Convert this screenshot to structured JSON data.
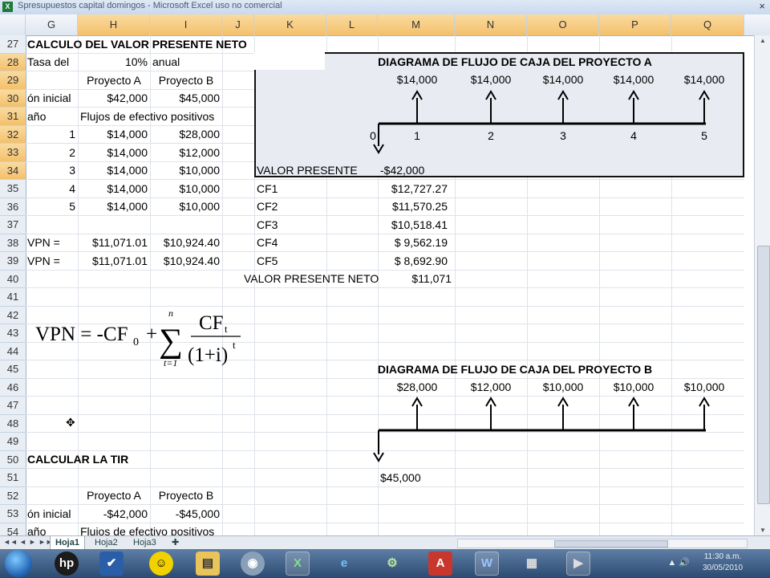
{
  "window": {
    "title": "Spresupuestos capital domingos - Microsoft Excel uso no comercial"
  },
  "columns": [
    "G",
    "H",
    "I",
    "J",
    "K",
    "L",
    "M",
    "N",
    "O",
    "P",
    "Q"
  ],
  "selected_columns": [
    "H",
    "I",
    "J",
    "K",
    "L",
    "M",
    "N",
    "O",
    "P",
    "Q"
  ],
  "rows": [
    "27",
    "28",
    "29",
    "30",
    "31",
    "32",
    "33",
    "34",
    "35",
    "36",
    "37",
    "38",
    "39",
    "40",
    "41",
    "42",
    "43",
    "44",
    "45",
    "46",
    "47",
    "48",
    "49",
    "50",
    "51",
    "52",
    "53",
    "54"
  ],
  "selected_rows": [
    "28",
    "29",
    "30",
    "31",
    "32",
    "33",
    "34"
  ],
  "cells": {
    "g27": "CALCULO DEL VALOR PRESENTE NETO",
    "g28": "Tasa del",
    "h28": "10%",
    "i28": "anual",
    "h29": "Proyecto A",
    "i29": "Proyecto B",
    "g30": "ón inicial",
    "h30": "$42,000",
    "i30": "$45,000",
    "g31": "año",
    "h31": "Flujos de efectivo positivos",
    "g32": "1",
    "h32": "$14,000",
    "i32": "$28,000",
    "g33": "2",
    "h33": "$14,000",
    "i33": "$12,000",
    "g34": "3",
    "h34": "$14,000",
    "i34": "$10,000",
    "g35": "4",
    "h35": "$14,000",
    "i35": "$10,000",
    "g36": "5",
    "h36": "$14,000",
    "i36": "$10,000",
    "g38": "VPN =",
    "h38": "$11,071.01",
    "i38": "$10,924.40",
    "g39": "VPN =",
    "h39": "$11,071.01",
    "i39": "$10,924.40",
    "k34": "VALOR PRESENTE",
    "m34": "-$42,000",
    "k35": "CF1",
    "m35": "$12,727.27",
    "k36": "CF2",
    "m36": "$11,570.25",
    "k37": "CF3",
    "m37": "$10,518.41",
    "k38": "CF4",
    "m38": "$  9,562.19",
    "k39": "CF5",
    "m39": "$  8,692.90",
    "k40": "VALOR PRESENTE NETO",
    "m40": "$11,071",
    "g50": "CALCULAR LA TIR",
    "h52": "Proyecto A",
    "i52": "Proyecto B",
    "g53": "ón inicial",
    "h53": "-$42,000",
    "i53": "-$45,000",
    "g54": "año",
    "h54": "Flujos de efectivo positivos"
  },
  "diagram_a": {
    "title": "DIAGRAMA DE FLUJO DE CAJA DEL PROYECTO A",
    "flows": [
      "$14,000",
      "$14,000",
      "$14,000",
      "$14,000",
      "$14,000"
    ],
    "periods": [
      "0",
      "1",
      "2",
      "3",
      "4",
      "5"
    ]
  },
  "diagram_b": {
    "title": "DIAGRAMA DE FLUJO DE CAJA DEL PROYECTO B",
    "flows": [
      "$28,000",
      "$12,000",
      "$10,000",
      "$10,000",
      "$10,000"
    ],
    "initial": "$45,000"
  },
  "formula": {
    "lhs": "VPN = -CF",
    "sub0": "0",
    "plus": "+",
    "sum_top": "n",
    "sum_bottom": "t=1",
    "num": "CF",
    "num_sub": "t",
    "den": "(1+i)",
    "den_sup": "t"
  },
  "sheets": [
    "Hoja1",
    "Hoja2",
    "Hoja3"
  ],
  "active_sheet": "Hoja1",
  "taskbar": {
    "clock_time": "11:30 a.m.",
    "clock_date": "30/05/2010",
    "hp_label": "hp"
  },
  "colors": {
    "selection_header": "#f4c06a",
    "diagram_fill": "#e9ebf2"
  }
}
